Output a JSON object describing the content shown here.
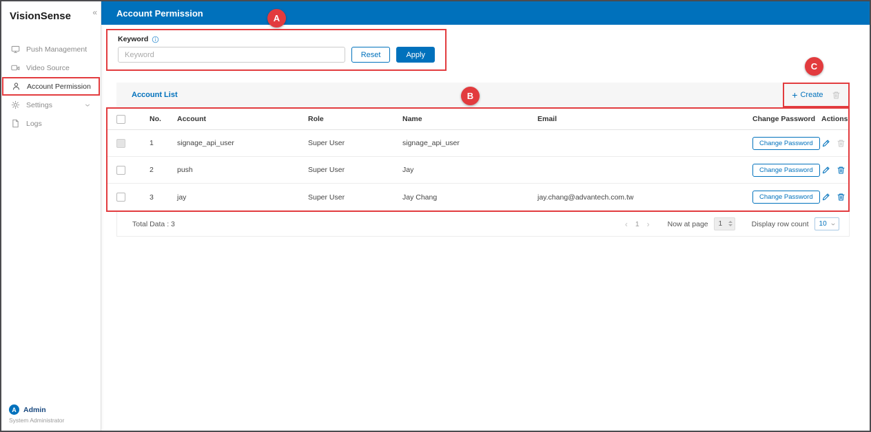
{
  "app": {
    "title": "VisionSense"
  },
  "icons": {
    "collapse": "«",
    "plus": "+",
    "prev": "‹",
    "next": "›"
  },
  "sidebar": {
    "items": [
      {
        "label": "Push Management"
      },
      {
        "label": "Video Source"
      },
      {
        "label": "Account Permission"
      },
      {
        "label": "Settings"
      },
      {
        "label": "Logs"
      }
    ],
    "user": {
      "name": "Admin",
      "role": "System Administrator",
      "avatar_initial": "A"
    }
  },
  "header": {
    "title": "Account Permission"
  },
  "search": {
    "label": "Keyword",
    "placeholder": "Keyword",
    "reset_label": "Reset",
    "apply_label": "Apply"
  },
  "account_list": {
    "title": "Account List",
    "create_label": "Create",
    "table": {
      "headers": [
        "No.",
        "Account",
        "Role",
        "Name",
        "Email",
        "Change Password",
        "Actions"
      ],
      "change_password_label": "Change Password",
      "rows": [
        {
          "no": "1",
          "account": "signage_api_user",
          "role": "Super User",
          "name": "signage_api_user",
          "email": ""
        },
        {
          "no": "2",
          "account": "push",
          "role": "Super User",
          "name": "Jay",
          "email": ""
        },
        {
          "no": "3",
          "account": "jay",
          "role": "Super User",
          "name": "Jay Chang",
          "email": "jay.chang@advantech.com.tw"
        }
      ]
    },
    "footer": {
      "total_label": "Total Data : 3",
      "current_page": "1",
      "now_at_page_label": "Now at page",
      "page_input_value": "1",
      "display_row_count_label": "Display row count",
      "row_count_value": "10"
    }
  },
  "annotations": {
    "a": "A",
    "b": "B",
    "c": "C"
  },
  "colors": {
    "primary_blue": "#0071BC",
    "annotation_red": "#E23B3E"
  }
}
